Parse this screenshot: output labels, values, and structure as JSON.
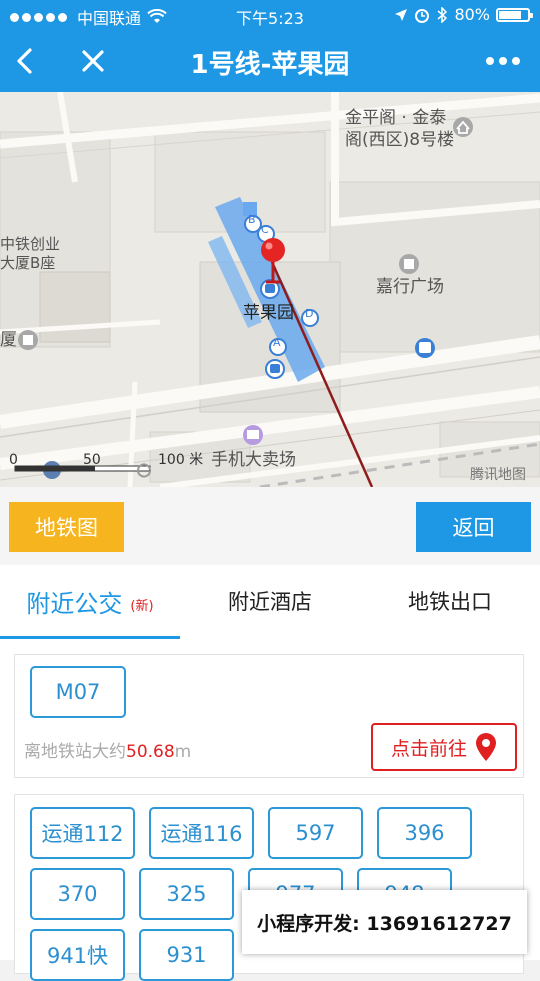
{
  "status": {
    "carrier": "中国联通",
    "time": "下午5:23",
    "battery": "80%",
    "battery_level": 0.8
  },
  "nav": {
    "title": "1号线-苹果园"
  },
  "map": {
    "labels": {
      "jinping": "金平阁 · 金泰\n阁(西区)8号楼",
      "zhongtie": "中铁创业\n大厦B座",
      "xia": "厦",
      "jiaxing": "嘉行广场",
      "station": "苹果园",
      "phone_mall": "手机大卖场"
    },
    "scale": {
      "t0": "0",
      "t1": "50",
      "t2": "100 米"
    },
    "provider": "腾讯地图",
    "exits": [
      "B",
      "C",
      "D",
      "A"
    ]
  },
  "buttons": {
    "metro_map": "地铁图",
    "back": "返回"
  },
  "tabs": [
    {
      "label": "附近公交",
      "badge": "(新)"
    },
    {
      "label": "附近酒店"
    },
    {
      "label": "地铁出口"
    }
  ],
  "bus_stop": {
    "route": "M07",
    "distance_prefix": "离地铁站大约",
    "distance_value": "50.68",
    "distance_unit": "m",
    "goto_label": "点击前往"
  },
  "routes": [
    "运通112",
    "运通116",
    "597",
    "396",
    "370",
    "325",
    "977",
    "948",
    "941快",
    "931"
  ],
  "watermark": "小程序开发: 13691612727",
  "colors": {
    "primary": "#1e98e4",
    "accent": "#f6b51e",
    "danger": "#e02020"
  }
}
